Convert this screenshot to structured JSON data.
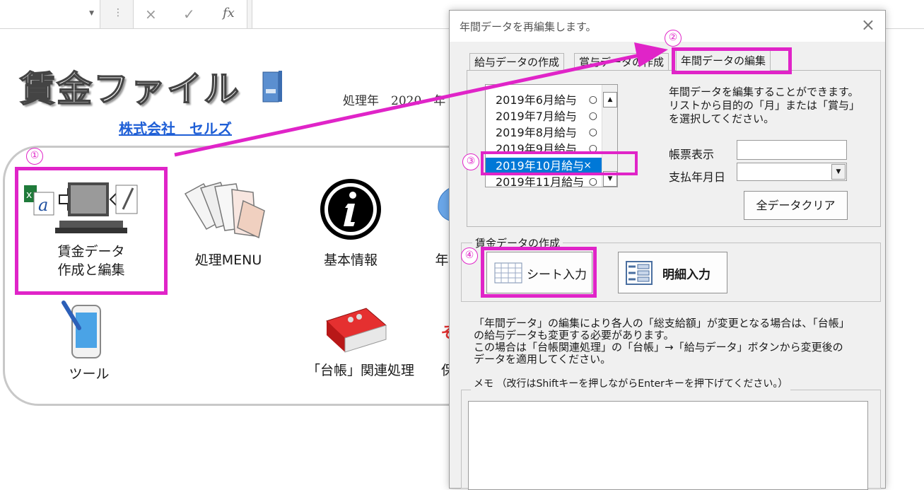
{
  "formula_bar": {
    "cancel_icon": "×",
    "enter_icon": "✓",
    "fx_label": "fx"
  },
  "sheet": {
    "logo_title": "賃金ファイル",
    "company": "株式会社　セルズ",
    "processing_year": "処理年　2020　年"
  },
  "tiles": {
    "wage_data_line1": "賃金データ",
    "wage_data_line2": "作成と編集",
    "menu": "処理MENU",
    "basic_info": "基本情報",
    "partial_nen": "年",
    "tools": "ツール",
    "ledger": "「台帳」関連処理",
    "partial_ho": "保"
  },
  "badges": {
    "b1": "①",
    "b2": "②",
    "b3": "③",
    "b4": "④"
  },
  "dialog": {
    "title": "年間データを再編集します。",
    "tabs": [
      "給与データの作成",
      "賞与データの作成",
      "年間データの編集"
    ],
    "list": [
      {
        "label": "2019年6月給与",
        "mark": "○"
      },
      {
        "label": "2019年7月給与",
        "mark": "○"
      },
      {
        "label": "2019年8月給与",
        "mark": "○"
      },
      {
        "label": "2019年9月給与",
        "mark": "○"
      },
      {
        "label": "2019年10月給与",
        "mark": "×"
      },
      {
        "label": "2019年11月給与",
        "mark": "○"
      }
    ],
    "help_text": [
      "年間データを編集することができます。",
      "リストから目的の「月」または「賞与」",
      "を選択してください。"
    ],
    "report_label": "帳票表示",
    "paydate_label": "支払年月日",
    "clear_all_button": "全データクリア",
    "wage_group_title": "賃金データの作成",
    "sheet_input_button": "シート入力",
    "detail_input_button": "明細入力",
    "note": [
      "「年間データ」の編集により各人の「総支給額」が変更となる場合は、「台帳」",
      "の給与データも変更する必要があります。",
      "この場合は「台帳関連処理」の「台帳」→「給与データ」ボタンから変更後の",
      "データを適用してください。"
    ],
    "memo_title": "メモ （改行はShiftキーを押しながらEnterキーを押下げてください。）"
  },
  "colors": {
    "highlight": "#e024c8",
    "selection": "#0078d7",
    "link": "#1f5fd6"
  }
}
